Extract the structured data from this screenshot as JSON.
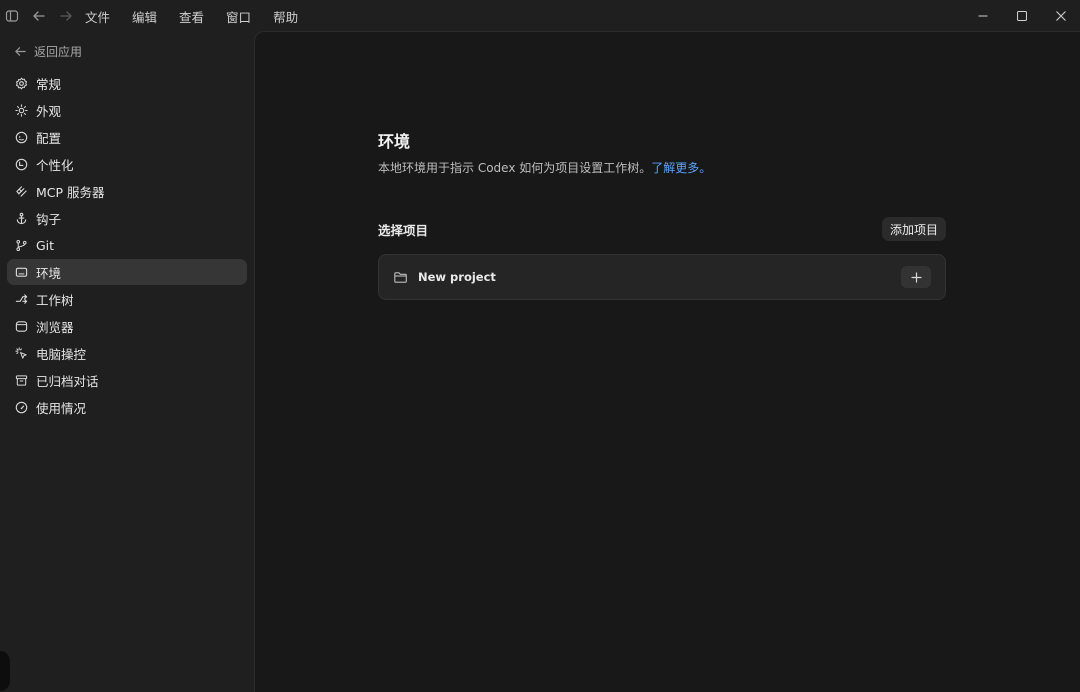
{
  "titlebar": {
    "menu": [
      "文件",
      "编辑",
      "查看",
      "窗口",
      "帮助"
    ],
    "icons": [
      "sidebar-toggle-icon",
      "back-arrow-icon",
      "forward-arrow-icon"
    ],
    "window_controls": [
      "minimize-icon",
      "maximize-icon",
      "close-icon"
    ]
  },
  "sidebar": {
    "back_label": "返回应用",
    "items": [
      {
        "label": "常规",
        "icon": "gear-icon"
      },
      {
        "label": "外观",
        "icon": "sun-icon"
      },
      {
        "label": "配置",
        "icon": "config-icon"
      },
      {
        "label": "个性化",
        "icon": "personalize-icon"
      },
      {
        "label": "MCP 服务器",
        "icon": "mcp-icon"
      },
      {
        "label": "钩子",
        "icon": "anchor-icon"
      },
      {
        "label": "Git",
        "icon": "git-branch-icon"
      },
      {
        "label": "环境",
        "icon": "monitor-icon",
        "active": true
      },
      {
        "label": "工作树",
        "icon": "worktree-icon"
      },
      {
        "label": "浏览器",
        "icon": "browser-icon"
      },
      {
        "label": "电脑操控",
        "icon": "cursor-click-icon"
      },
      {
        "label": "已归档对话",
        "icon": "archive-icon"
      },
      {
        "label": "使用情况",
        "icon": "gauge-icon"
      }
    ]
  },
  "main": {
    "title": "环境",
    "description": "本地环境用于指示 Codex 如何为项目设置工作树。",
    "learn_more": "了解更多。",
    "section_label": "选择项目",
    "add_project_label": "添加项目",
    "project_name": "New project"
  },
  "colors": {
    "background": "#1f1f1f",
    "main_background": "#181818",
    "active_item": "#363636",
    "link": "#5aa2ff"
  }
}
